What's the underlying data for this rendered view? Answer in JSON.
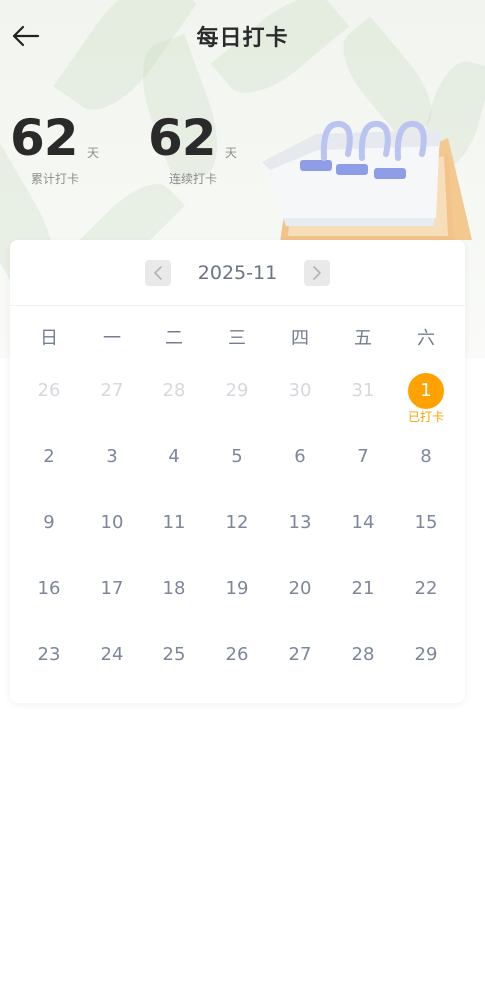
{
  "header": {
    "title": "每日打卡"
  },
  "stats": {
    "total": {
      "value": "62",
      "unit": "天",
      "label": "累计打卡"
    },
    "streak": {
      "value": "62",
      "unit": "天",
      "label": "连续打卡"
    }
  },
  "calendar": {
    "month": "2025-11",
    "weekdays": [
      "日",
      "一",
      "二",
      "三",
      "四",
      "五",
      "六"
    ],
    "signed_tag": "已打卡",
    "weeks": [
      [
        {
          "day": "26",
          "other": true
        },
        {
          "day": "27",
          "other": true
        },
        {
          "day": "28",
          "other": true
        },
        {
          "day": "29",
          "other": true
        },
        {
          "day": "30",
          "other": true
        },
        {
          "day": "31",
          "other": true
        },
        {
          "day": "1",
          "signed": true
        }
      ],
      [
        {
          "day": "2"
        },
        {
          "day": "3"
        },
        {
          "day": "4"
        },
        {
          "day": "5"
        },
        {
          "day": "6"
        },
        {
          "day": "7"
        },
        {
          "day": "8"
        }
      ],
      [
        {
          "day": "9"
        },
        {
          "day": "10"
        },
        {
          "day": "11"
        },
        {
          "day": "12"
        },
        {
          "day": "13"
        },
        {
          "day": "14"
        },
        {
          "day": "15"
        }
      ],
      [
        {
          "day": "16"
        },
        {
          "day": "17"
        },
        {
          "day": "18"
        },
        {
          "day": "19"
        },
        {
          "day": "20"
        },
        {
          "day": "21"
        },
        {
          "day": "22"
        }
      ],
      [
        {
          "day": "23"
        },
        {
          "day": "24"
        },
        {
          "day": "25"
        },
        {
          "day": "26"
        },
        {
          "day": "27"
        },
        {
          "day": "28"
        },
        {
          "day": "29"
        }
      ]
    ]
  },
  "icons": {
    "back": "arrow-left-icon",
    "prev": "chevron-left-icon",
    "next": "chevron-right-icon"
  },
  "colors": {
    "accent": "#ffa200",
    "text_primary": "#2a2a2a",
    "text_muted": "#7d869a",
    "text_disabled": "#d6d8dd"
  }
}
